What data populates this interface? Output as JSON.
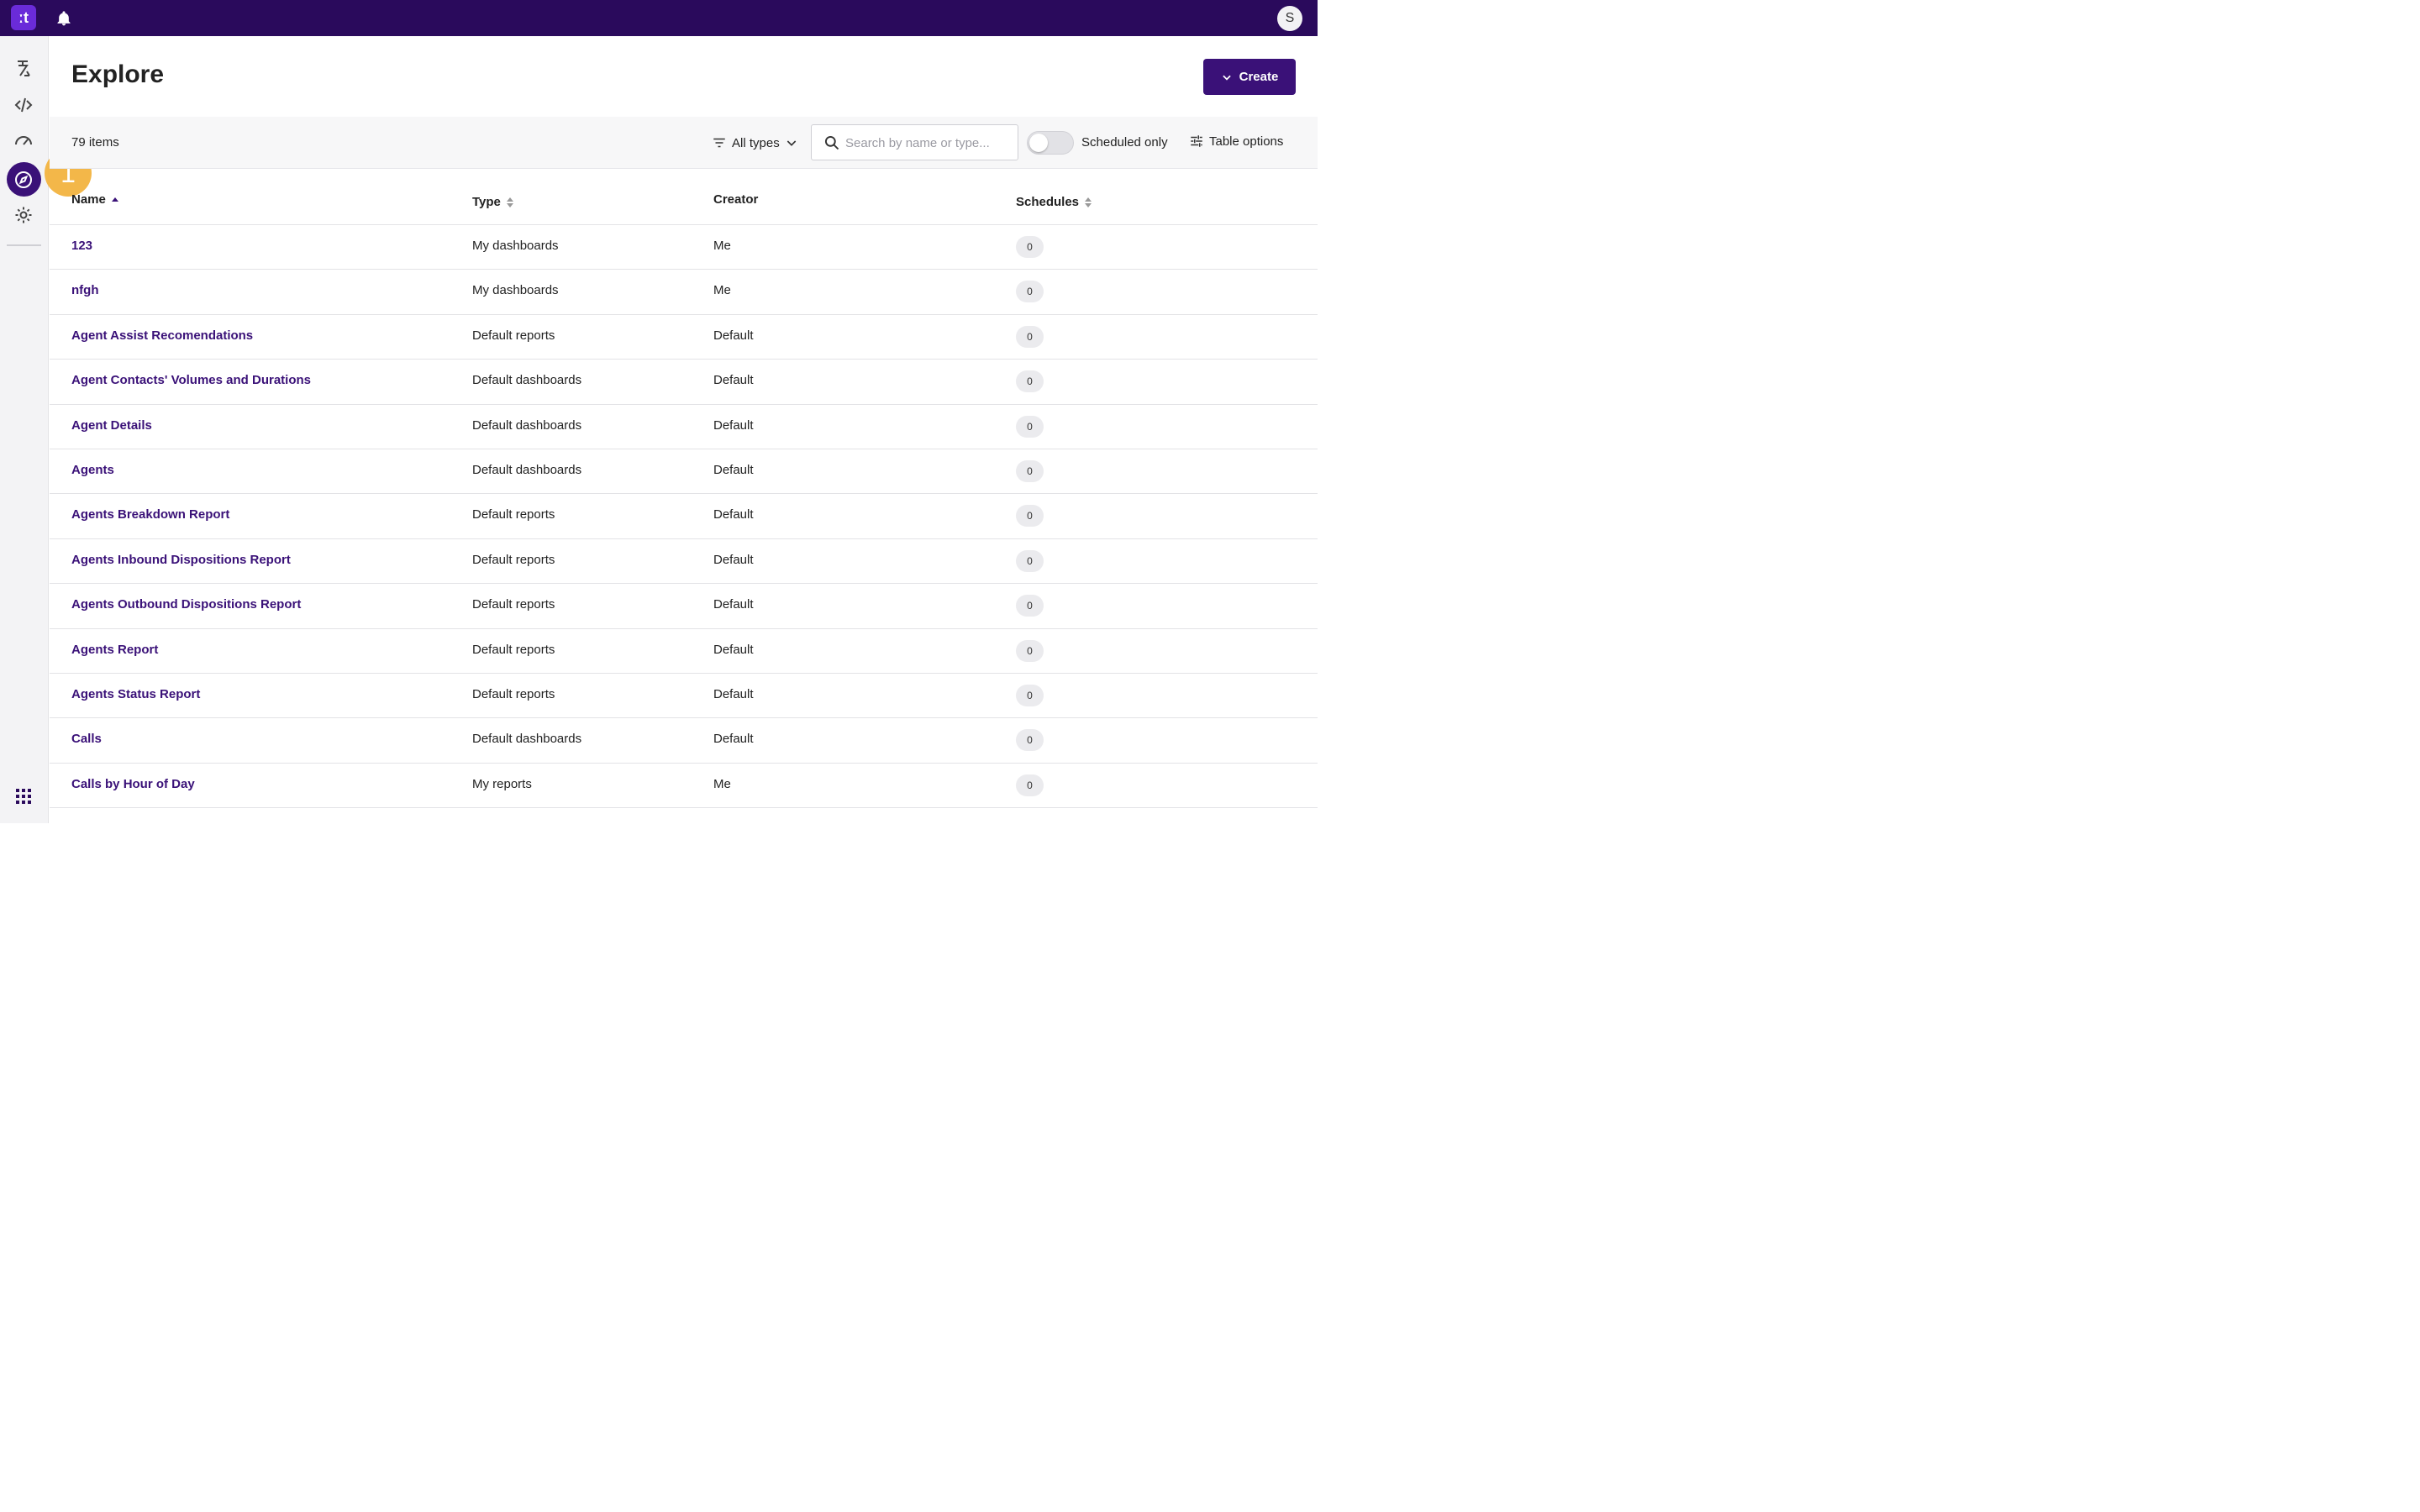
{
  "app": {
    "logo_text": "ːt",
    "avatar_initial": "S"
  },
  "header": {
    "title": "Explore",
    "create_label": "Create"
  },
  "toolbar": {
    "item_count": "79 items",
    "filter_label": "All types",
    "search_placeholder": "Search by name or type...",
    "search_value": "",
    "toggle_label": "Scheduled only",
    "toggle_on": false,
    "table_options_label": "Table options"
  },
  "step_badge": "1",
  "columns": {
    "name": "Name",
    "type": "Type",
    "creator": "Creator",
    "schedules": "Schedules"
  },
  "rows": [
    {
      "name": "123",
      "type": "My dashboards",
      "creator": "Me",
      "schedules": "0"
    },
    {
      "name": "nfgh",
      "type": "My dashboards",
      "creator": "Me",
      "schedules": "0"
    },
    {
      "name": "Agent Assist Recomendations",
      "type": "Default reports",
      "creator": "Default",
      "schedules": "0"
    },
    {
      "name": "Agent Contacts' Volumes and Durations",
      "type": "Default dashboards",
      "creator": "Default",
      "schedules": "0"
    },
    {
      "name": "Agent Details",
      "type": "Default dashboards",
      "creator": "Default",
      "schedules": "0"
    },
    {
      "name": "Agents",
      "type": "Default dashboards",
      "creator": "Default",
      "schedules": "0"
    },
    {
      "name": "Agents Breakdown Report",
      "type": "Default reports",
      "creator": "Default",
      "schedules": "0"
    },
    {
      "name": "Agents Inbound Dispositions Report",
      "type": "Default reports",
      "creator": "Default",
      "schedules": "0"
    },
    {
      "name": "Agents Outbound Dispositions Report",
      "type": "Default reports",
      "creator": "Default",
      "schedules": "0"
    },
    {
      "name": "Agents Report",
      "type": "Default reports",
      "creator": "Default",
      "schedules": "0"
    },
    {
      "name": "Agents Status Report",
      "type": "Default reports",
      "creator": "Default",
      "schedules": "0"
    },
    {
      "name": "Calls",
      "type": "Default dashboards",
      "creator": "Default",
      "schedules": "0"
    },
    {
      "name": "Calls by Hour of Day",
      "type": "My reports",
      "creator": "Me",
      "schedules": "0"
    }
  ],
  "colors": {
    "topbar": "#2a0a5c",
    "accent": "#3a1178",
    "logo": "#6a2bd9",
    "badge": "#f3b440"
  }
}
